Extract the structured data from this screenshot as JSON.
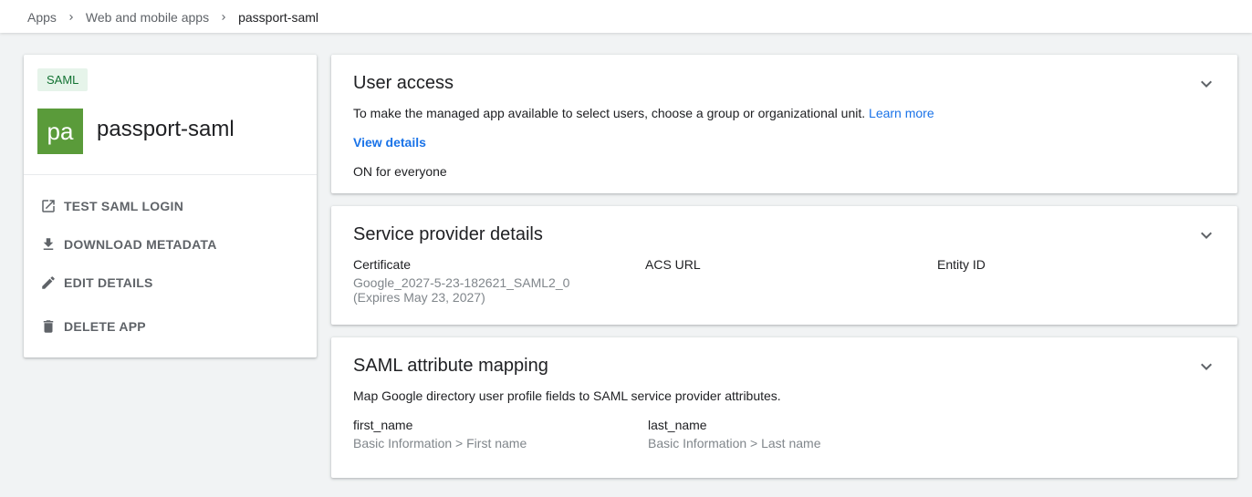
{
  "breadcrumb": {
    "items": [
      "Apps",
      "Web and mobile apps",
      "passport-saml"
    ]
  },
  "app": {
    "badge": "SAML",
    "tile_text": "pa",
    "name": "passport-saml",
    "tile_color": "#5a9b3a",
    "actions": [
      {
        "label": "TEST SAML LOGIN",
        "icon": "open-in-new-icon"
      },
      {
        "label": "DOWNLOAD METADATA",
        "icon": "download-icon"
      },
      {
        "label": "EDIT DETAILS",
        "icon": "pencil-icon"
      },
      {
        "label": "DELETE APP",
        "icon": "trash-icon"
      }
    ]
  },
  "user_access": {
    "title": "User access",
    "description": "To make the managed app available to select users, choose a group or organizational unit.",
    "learn_more": "Learn more",
    "view_details": "View details",
    "status": "ON for everyone"
  },
  "service_provider": {
    "title": "Service provider details",
    "certificate_label": "Certificate",
    "certificate_value": "Google_2027-5-23-182621_SAML2_0",
    "certificate_expiry": "(Expires May 23, 2027)",
    "acs_label": "ACS URL",
    "entity_label": "Entity ID"
  },
  "attribute_mapping": {
    "title": "SAML attribute mapping",
    "description": "Map Google directory user profile fields to SAML service provider attributes.",
    "mappings": [
      {
        "attribute": "first_name",
        "source": "Basic Information > First name"
      },
      {
        "attribute": "last_name",
        "source": "Basic Information > Last name"
      }
    ]
  },
  "colors": {
    "accent": "#1a73e8",
    "badge_bg": "#e6f4ea",
    "badge_text": "#137333"
  }
}
